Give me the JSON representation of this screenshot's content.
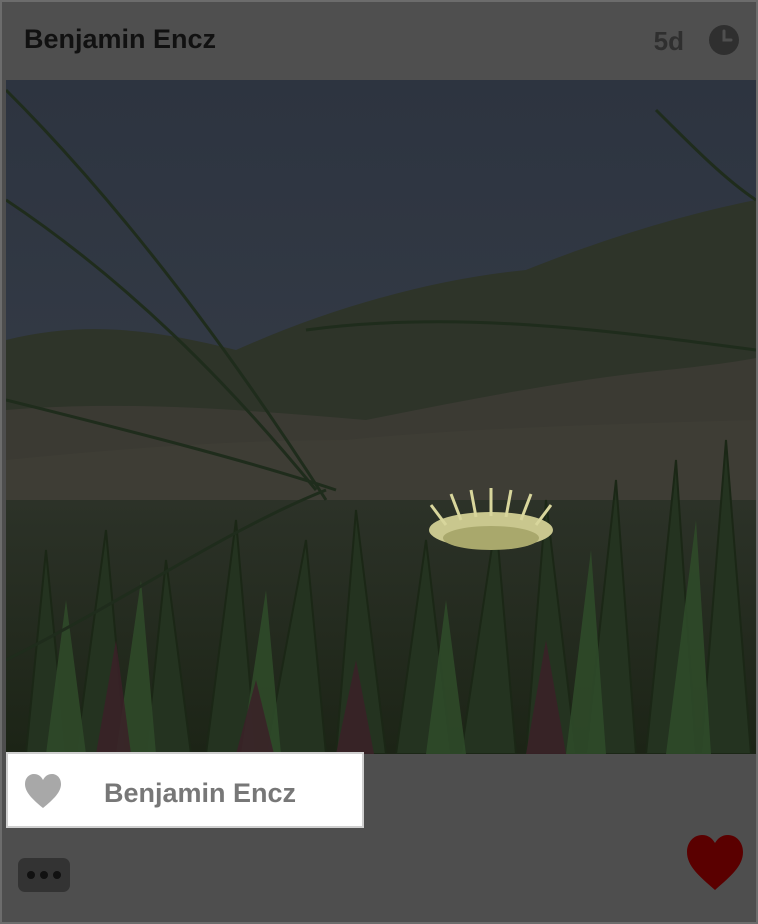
{
  "post": {
    "author": "Benjamin Encz",
    "time_ago": "5d",
    "photo_alt": "Yellow flower among green succulent plants and grass blades",
    "likes": {
      "users": [
        "Benjamin Encz"
      ]
    }
  },
  "icons": {
    "clock": "clock-icon",
    "like_heart_outline": "heart-icon",
    "like_button": "heart-icon",
    "more_button": "ellipsis-icon"
  },
  "colors": {
    "like_heart_color": "#5a0000",
    "likes_heart_color": "#a8a8a8"
  }
}
